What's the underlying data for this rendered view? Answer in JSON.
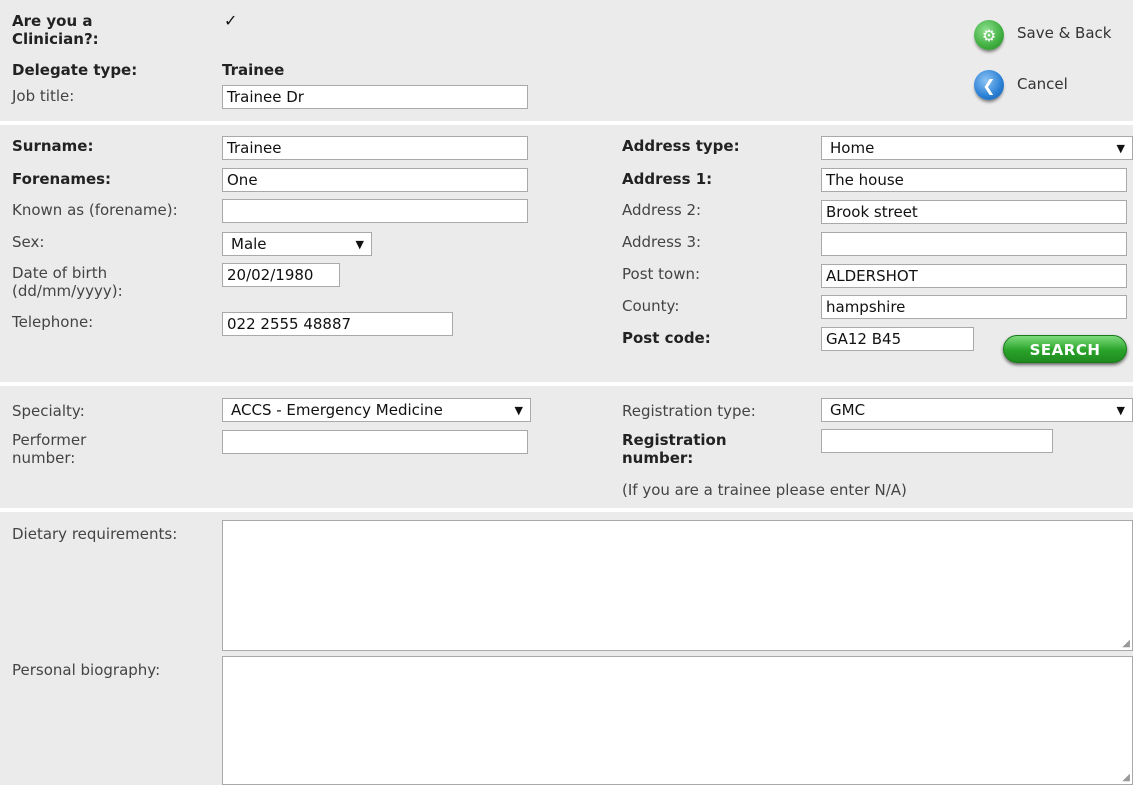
{
  "header": {
    "clinician_label": "Are you a Clinician?:",
    "clinician_value": "✓",
    "delegate_type_label": "Delegate type:",
    "delegate_type_value": "Trainee",
    "job_title_label": "Job title:",
    "job_title_value": "Trainee Dr"
  },
  "actions": {
    "save_back_label": "Save & Back",
    "cancel_label": "Cancel"
  },
  "personal": {
    "surname_label": "Surname:",
    "surname_value": "Trainee",
    "forenames_label": "Forenames:",
    "forenames_value": "One",
    "known_as_label": "Known as (forename):",
    "known_as_value": "",
    "sex_label": "Sex:",
    "sex_value": "Male",
    "dob_label_line1": "Date of birth",
    "dob_label_line2": "(dd/mm/yyyy):",
    "dob_value": "20/02/1980",
    "telephone_label": "Telephone:",
    "telephone_value": "022 2555 48887"
  },
  "address": {
    "type_label": "Address type:",
    "type_value": "Home",
    "line1_label": "Address 1:",
    "line1_value": "The house",
    "line2_label": "Address 2:",
    "line2_value": "Brook street",
    "line3_label": "Address 3:",
    "line3_value": "",
    "town_label": "Post town:",
    "town_value": "ALDERSHOT",
    "county_label": "County:",
    "county_value": "hampshire",
    "postcode_label": "Post code:",
    "postcode_value": "GA12 B45",
    "search_label": "SEARCH"
  },
  "professional": {
    "specialty_label": "Specialty:",
    "specialty_value": "ACCS - Emergency Medicine",
    "performer_label_line1": "Performer",
    "performer_label_line2": "number:",
    "performer_value": "",
    "reg_type_label": "Registration type:",
    "reg_type_value": "GMC",
    "reg_number_label_line1": "Registration",
    "reg_number_label_line2": "number:",
    "reg_number_value": "",
    "reg_hint": "(If you are a trainee please enter N/A)"
  },
  "extra": {
    "dietary_label": "Dietary requirements:",
    "dietary_value": "",
    "biography_label": "Personal biography:",
    "biography_value": ""
  },
  "icons": {
    "save": "gear-icon",
    "cancel": "back-arrow-icon",
    "dropdown": "chevron-down-icon",
    "resize": "resize-grip-icon"
  },
  "colors": {
    "section_bg": "#ebebeb",
    "save_icon": "#3fae3f",
    "cancel_icon": "#2a7fd4",
    "search_button": "#2aa32a"
  }
}
